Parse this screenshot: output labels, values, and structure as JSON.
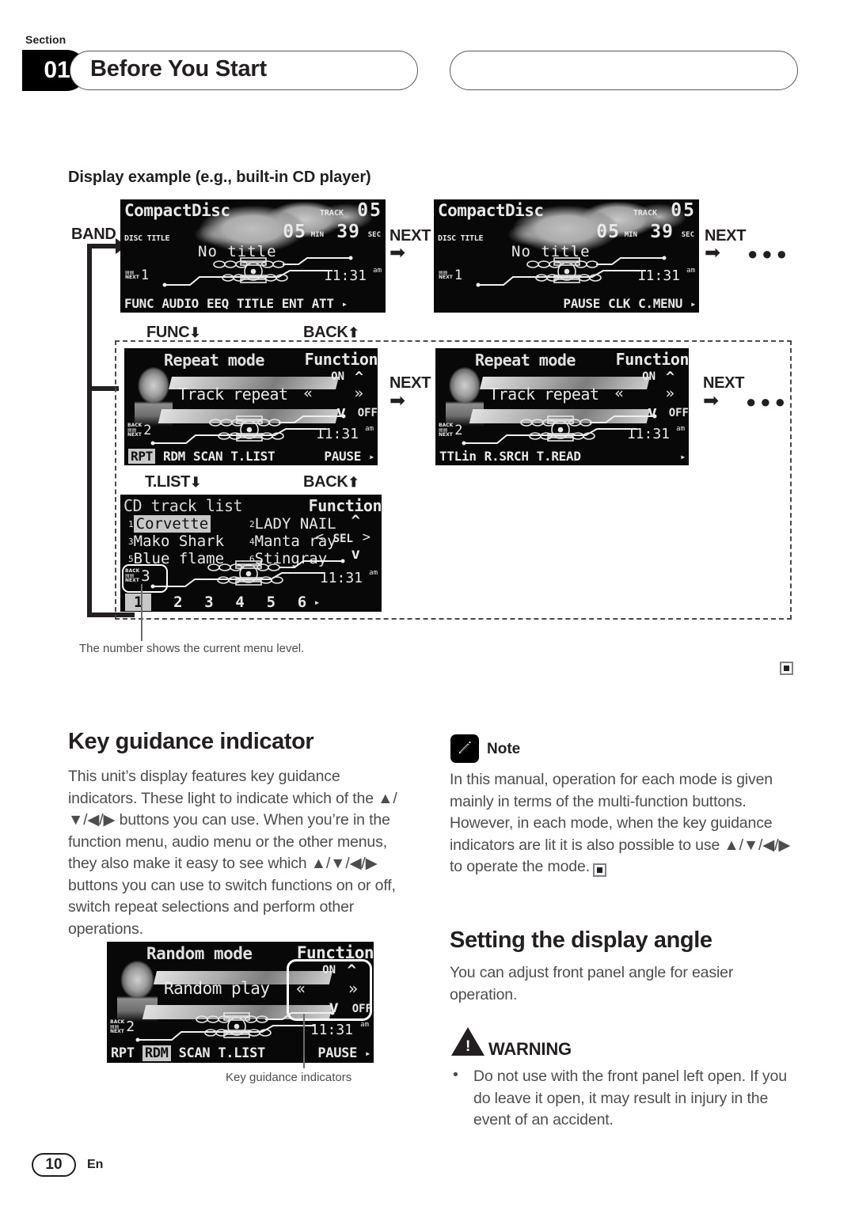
{
  "header": {
    "section_label": "Section",
    "section_number": "01",
    "title": "Before You Start"
  },
  "subheading": "Display example (e.g., built-in CD player)",
  "flow": {
    "band_label": "BAND",
    "func_label": "FUNC",
    "back_label": "BACK",
    "tlist_label": "T.LIST",
    "next_label": "NEXT",
    "dots": "●●●",
    "arrow_right": "➡",
    "arrow_down": "⬇",
    "arrow_up": "⬆"
  },
  "screens": {
    "cd_play_1": {
      "source": "CompactDisc",
      "track_label": "TRACK",
      "track_number": "05",
      "min_value": "05",
      "min_label": "MIN",
      "sec_value": "39",
      "sec_label": "SEC",
      "disc_title_label": "DISC TITLE",
      "disc_title": "No title",
      "clock": "11:31",
      "clock_ampm": "am",
      "level_next": "NEXT",
      "level": "1",
      "softkeys": [
        "FUNC",
        "AUDIO",
        "EEQ",
        "TITLE",
        "ENT",
        "ATT"
      ],
      "more": "▸"
    },
    "cd_play_2": {
      "source": "CompactDisc",
      "track_label": "TRACK",
      "track_number": "05",
      "min_value": "05",
      "min_label": "MIN",
      "sec_value": "39",
      "sec_label": "SEC",
      "disc_title_label": "DISC TITLE",
      "disc_title": "No title",
      "clock": "11:31",
      "clock_ampm": "am",
      "level_next": "NEXT",
      "level": "1",
      "softkeys": [
        "PAUSE",
        "CLK",
        "C.MENU"
      ],
      "more": "▸"
    },
    "repeat_1": {
      "title": "Repeat mode",
      "menu_label": "Function",
      "value": "Track repeat",
      "on_label": "ON",
      "off_label": "OFF",
      "clock": "11:31",
      "clock_ampm": "am",
      "level_back": "BACK",
      "level_next": "NEXT",
      "level": "2",
      "softkeys": [
        "RPT",
        "RDM",
        "SCAN",
        "T.LIST"
      ],
      "softkey_selected": "RPT",
      "right_key": "PAUSE",
      "more": "▸"
    },
    "repeat_2": {
      "title": "Repeat mode",
      "menu_label": "Function",
      "value": "Track repeat",
      "on_label": "ON",
      "off_label": "OFF",
      "clock": "11:31",
      "clock_ampm": "am",
      "level_back": "BACK",
      "level_next": "NEXT",
      "level": "2",
      "softkeys": [
        "TTLin",
        "R.SRCH",
        "T.READ"
      ],
      "more": "▸"
    },
    "track_list": {
      "title": "CD track list",
      "menu_label": "Function",
      "sel_label": "SEL",
      "tracks": [
        {
          "no": "1",
          "name": "Corvette",
          "selected": true
        },
        {
          "no": "2",
          "name": "LADY NAIL",
          "selected": false
        },
        {
          "no": "3",
          "name": "Mako Shark",
          "selected": false
        },
        {
          "no": "4",
          "name": "Manta ray",
          "selected": false
        },
        {
          "no": "5",
          "name": "Blue flame",
          "selected": false
        },
        {
          "no": "6",
          "name": "Stingray",
          "selected": false
        }
      ],
      "clock": "11:31",
      "clock_ampm": "am",
      "level_back": "BACK",
      "level_next": "NEXT",
      "level": "3",
      "pager": [
        "1",
        "2",
        "3",
        "4",
        "5",
        "6"
      ],
      "pager_selected": "1",
      "more": "▸"
    },
    "random": {
      "title": "Random mode",
      "menu_label": "Function",
      "value": "Random play",
      "on_label": "ON",
      "off_label": "OFF",
      "clock": "11:31",
      "clock_ampm": "am",
      "level_back": "BACK",
      "level_next": "NEXT",
      "level": "2",
      "softkeys": [
        "RPT",
        "RDM",
        "SCAN",
        "T.LIST"
      ],
      "softkey_selected": "RDM",
      "right_key": "PAUSE",
      "more": "▸"
    }
  },
  "captions": {
    "menu_level": "The number shows the current menu level.",
    "key_guidance": "Key guidance indicators"
  },
  "key_guidance": {
    "heading": "Key guidance indicator",
    "body": "This unit’s display features key guidance indicators. These light to indicate which of the ▲/▼/◀/▶ buttons you can use. When you’re in the function menu, audio menu or the other menus, they also make it easy to see which ▲/▼/◀/▶ buttons you can use to switch functions on or off, switch repeat selections and perform other operations."
  },
  "note": {
    "label": "Note",
    "body": "In this manual, operation for each mode is given mainly in terms of the multi-function buttons. However, in each mode, when the key guidance indicators are lit it is also possible to use ▲/▼/◀/▶ to operate the mode."
  },
  "display_angle": {
    "heading": "Setting the display angle",
    "body": "You can adjust front panel angle for easier operation."
  },
  "warning": {
    "label": "WARNING",
    "bullet_mark": "•",
    "items": [
      "Do not use with the front panel left open. If you do leave it open, it may result in injury in the event of an accident."
    ]
  },
  "footer": {
    "page_number": "10",
    "language": "En"
  }
}
